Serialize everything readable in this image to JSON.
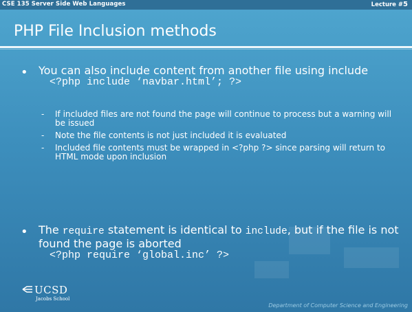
{
  "header": {
    "course": "CSE 135 Server Side Web Languages",
    "lecture_label": "Lecture #",
    "lecture_num": "5"
  },
  "slide": {
    "title": "PHP File Inclusion methods",
    "bullet1": {
      "text_a": "You can also include content from another file using",
      "text_b": "include",
      "code": "<?php include ‘navbar.html’;  ?>"
    },
    "subpoints": [
      "If included files are not found the page will continue to process but a warning will be issued",
      "Note the file contents is not just included it is evaluated",
      "Included file contents must be wrapped in <?php ?> since parsing will return to HTML mode upon inclusion"
    ],
    "bullet2": {
      "pre": "The ",
      "kw1": "require",
      "mid": " statement is identical to ",
      "kw2": "include",
      "post": ", but if the file is not found the page is aborted",
      "code": "<?php require ‘global.inc’ ?>"
    },
    "bullet_char": "•",
    "dash_char": "-"
  },
  "footer": {
    "logo_text": "UCSD",
    "logo_sub": "Jacobs School",
    "dept": "Department of Computer Science and Engineering"
  }
}
